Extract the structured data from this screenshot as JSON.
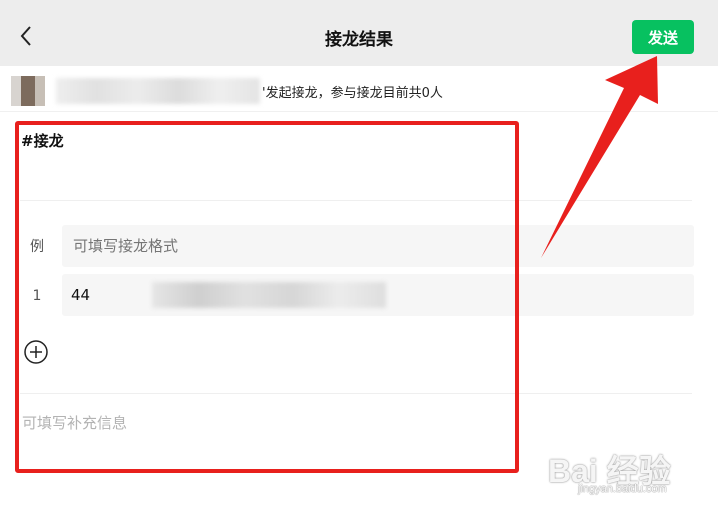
{
  "header": {
    "title": "接龙结果",
    "send_label": "发送"
  },
  "info": {
    "text": "'发起接龙，参与接龙目前共0人"
  },
  "card": {
    "hashtag": "#接龙",
    "example_index": "例",
    "example_placeholder": "可填写接龙格式",
    "entries": [
      {
        "index": "1",
        "value": "44"
      }
    ],
    "note_placeholder": "可填写补充信息"
  },
  "watermark": {
    "brand": "Bai 经验",
    "url": "jingyan.baidu.com"
  },
  "colors": {
    "accent_green": "#07c160",
    "highlight_red": "#e8201d",
    "header_bg": "#ededed"
  },
  "icons": {
    "back": "chevron-left-icon",
    "add": "plus-circle-icon"
  }
}
